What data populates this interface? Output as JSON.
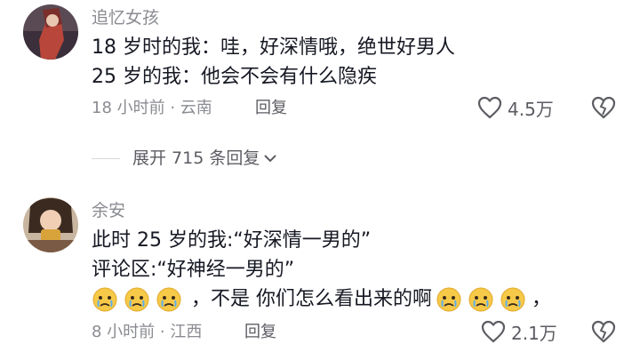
{
  "comments": [
    {
      "username": "追忆女孩",
      "lines": [
        "18 岁时的我：哇，好深情哦，绝世好男人",
        "25 岁的我：他会不会有什么隐疾"
      ],
      "meta": "18 小时前 · 云南",
      "reply_label": "回复",
      "like_count": "4.5万"
    },
    {
      "username": "余安",
      "lines": [
        "此时 25 岁的我:“好深情一男的”",
        "评论区:“好神经一男的”"
      ],
      "line3_text": "，不是 你们怎么看出来的啊",
      "line3_suffix": "，",
      "meta": "8 小时前 · 江西",
      "reply_label": "回复",
      "like_count": "2.1万"
    }
  ],
  "expand_replies": {
    "label": "展开 715 条回复"
  },
  "icons": {
    "like": "heart-outline-icon",
    "dislike": "broken-heart-icon",
    "expand": "chevron-down-icon",
    "emoji": "crying-face-emoji"
  },
  "colors": {
    "text": "#161823",
    "secondary": "#8a8b91",
    "action": "#5c5d63"
  }
}
